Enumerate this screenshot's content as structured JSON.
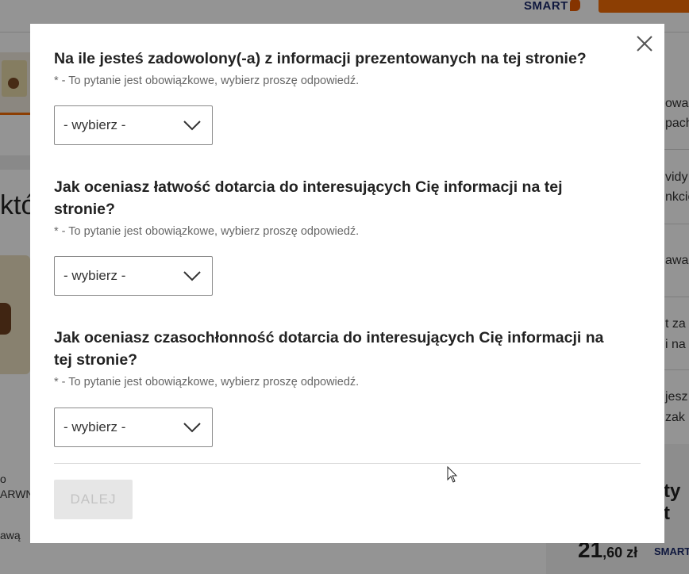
{
  "background": {
    "header_brand": "SMART",
    "big_text": "któ",
    "side_left_lines": [
      "o",
      "ARWN",
      "awą"
    ],
    "side_right_lines": [
      "owa",
      "pach",
      "vidy",
      "nkcie",
      "awa",
      "t za",
      "i na",
      "jesz",
      "zak"
    ],
    "price_integer": "21",
    "price_fraction": ",60 zł",
    "price_brand": "SMART",
    "heading_fragment": "ty t"
  },
  "modal": {
    "close_label": "×",
    "questions": [
      {
        "title": "Na ile jesteś zadowolony(-a) z informacji prezentowanych na tej stronie?",
        "note": "* - To pytanie jest obowiązkowe, wybierz proszę odpowiedź.",
        "select_value": "- wybierz -"
      },
      {
        "title": "Jak oceniasz łatwość dotarcia do interesujących Cię informacji na tej stronie?",
        "note": "* - To pytanie jest obowiązkowe, wybierz proszę odpowiedź.",
        "select_value": "- wybierz -"
      },
      {
        "title": "Jak oceniasz czasochłonność dotarcia do interesujących Cię informacji na tej stronie?",
        "note": "* - To pytanie jest obowiązkowe, wybierz proszę odpowiedź.",
        "select_value": "- wybierz -"
      }
    ],
    "next_button": "DALEJ"
  },
  "colors": {
    "accent": "#f26b06",
    "brand": "#1b2a6b",
    "disabled_bg": "#e6e6e6",
    "disabled_text": "#c3c3c3"
  },
  "icons": {
    "close": "close-icon",
    "dropdown": "chevron-down-icon",
    "cursor": "mouse-cursor"
  }
}
